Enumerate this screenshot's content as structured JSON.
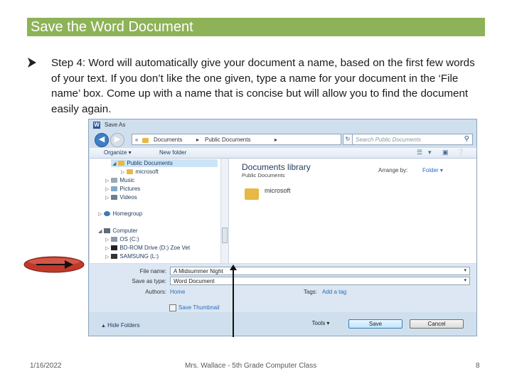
{
  "slide": {
    "title": "Save the Word Document",
    "body": "Step 4: Word will automatically give your document a name, based on the first few words of your text. If you don’t like the one given, type a name for your document in the ‘File name’ box. Come up with a name that is concise but will allow you to find the document easily again.",
    "footer_date": "1/16/2022",
    "footer_center": "Mrs. Wallace - 5th Grade Computer Class",
    "page_number": "8",
    "colors": {
      "title_bar": "#8db257",
      "title_text": "#ffffff",
      "pointer_arrow": "#c0392b"
    }
  },
  "dialog": {
    "title": "Save As",
    "app_icon": "W",
    "address": {
      "lead": "«",
      "part1": "Documents",
      "sep": "▸",
      "part2": "Public Documents",
      "end": "▸"
    },
    "search_placeholder": "Search Public Documents",
    "toolbar": {
      "organize": "Organize ▾",
      "new_folder": "New folder"
    },
    "nav": {
      "public_documents": "Public Documents",
      "microsoft": "microsoft",
      "music": "Music",
      "pictures": "Pictures",
      "videos": "Videos",
      "homegroup": "Homegroup",
      "computer": "Computer",
      "os": "OS (C:)",
      "bd_rom": "BD-ROM Drive (D:) Zoe Vet",
      "samsung": "SAMSUNG (L:)"
    },
    "library": {
      "title": "Documents library",
      "subtitle": "Public Documents",
      "arrange_label": "Arrange by:",
      "arrange_value": "Folder ▾",
      "item": "microsoft"
    },
    "form": {
      "file_name_label": "File name:",
      "file_name_value": "A Midsummer Night",
      "save_type_label": "Save as type:",
      "save_type_value": "Word Document",
      "authors_label": "Authors:",
      "authors_value": "Home",
      "tags_label": "Tags:",
      "tags_value": "Add a tag",
      "thumbnail_label": "Save Thumbnail"
    },
    "bottom": {
      "hide_folders": "Hide Folders",
      "tools": "Tools ▾",
      "save": "Save",
      "cancel": "Cancel"
    }
  }
}
